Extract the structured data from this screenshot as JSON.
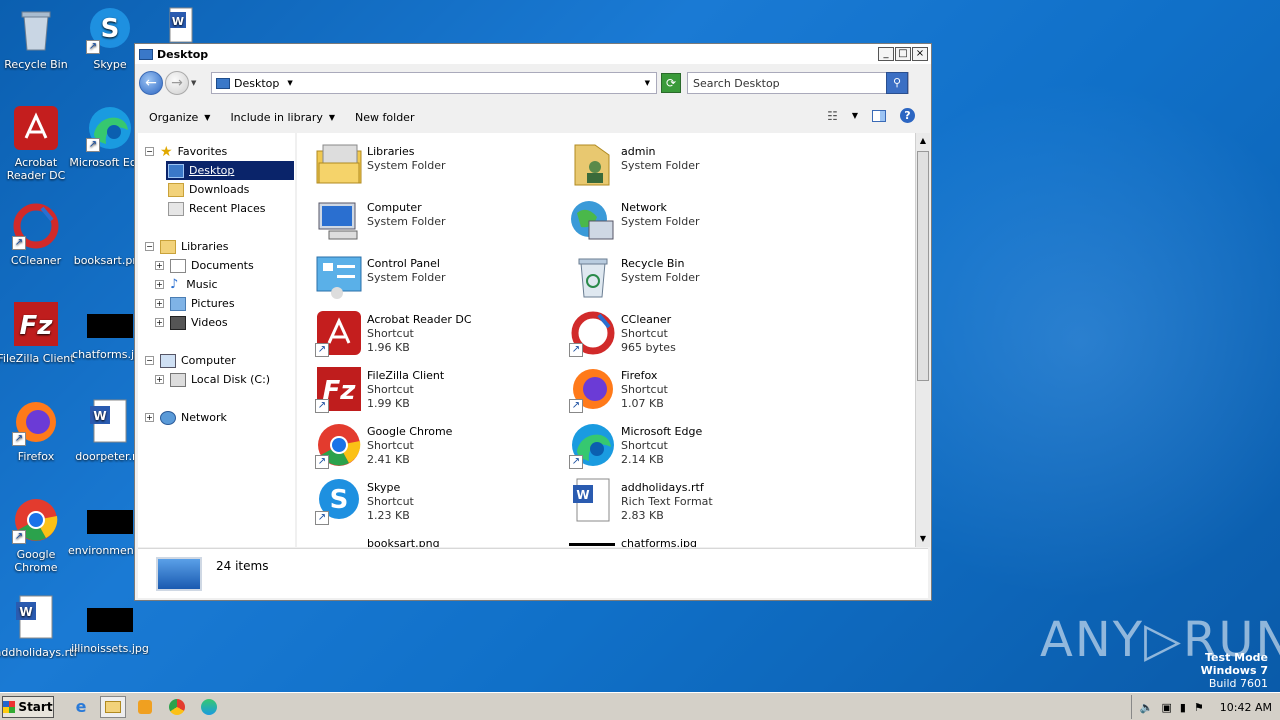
{
  "desktop": {
    "icons": [
      {
        "label": "Recycle Bin"
      },
      {
        "label": "Skype"
      },
      {
        "label": "Acrobat Reader DC"
      },
      {
        "label": "Microsoft Edge"
      },
      {
        "label": "CCleaner"
      },
      {
        "label": "booksart.png"
      },
      {
        "label": "FileZilla Client"
      },
      {
        "label": "chatforms.jpg"
      },
      {
        "label": "Firefox"
      },
      {
        "label": "doorpeter.rtf"
      },
      {
        "label": "Google Chrome"
      },
      {
        "label": "environmentwhere.jpg"
      },
      {
        "label": "addholidays.rtf"
      },
      {
        "label": "illinoissets.jpg"
      }
    ]
  },
  "window": {
    "title": "Desktop",
    "controls": {
      "minimize": "_",
      "maximize": "□",
      "close": "×"
    },
    "address": {
      "path": "Desktop"
    },
    "search": {
      "placeholder": "Search Desktop"
    },
    "toolbar": {
      "organize": "Organize",
      "include": "Include in library",
      "new_folder": "New folder"
    }
  },
  "nav": {
    "favorites": "Favorites",
    "desktop": "Desktop",
    "downloads": "Downloads",
    "recent": "Recent Places",
    "libraries": "Libraries",
    "documents": "Documents",
    "music": "Music",
    "pictures": "Pictures",
    "videos": "Videos",
    "computer": "Computer",
    "localdisk": "Local Disk (C:)",
    "network": "Network"
  },
  "items": [
    {
      "name": "Libraries",
      "type": "System Folder",
      "size": ""
    },
    {
      "name": "admin",
      "type": "System Folder",
      "size": ""
    },
    {
      "name": "Computer",
      "type": "System Folder",
      "size": ""
    },
    {
      "name": "Network",
      "type": "System Folder",
      "size": ""
    },
    {
      "name": "Control Panel",
      "type": "System Folder",
      "size": ""
    },
    {
      "name": "Recycle Bin",
      "type": "System Folder",
      "size": ""
    },
    {
      "name": "Acrobat Reader DC",
      "type": "Shortcut",
      "size": "1.96 KB"
    },
    {
      "name": "CCleaner",
      "type": "Shortcut",
      "size": "965 bytes"
    },
    {
      "name": "FileZilla Client",
      "type": "Shortcut",
      "size": "1.99 KB"
    },
    {
      "name": "Firefox",
      "type": "Shortcut",
      "size": "1.07 KB"
    },
    {
      "name": "Google Chrome",
      "type": "Shortcut",
      "size": "2.41 KB"
    },
    {
      "name": "Microsoft Edge",
      "type": "Shortcut",
      "size": "2.14 KB"
    },
    {
      "name": "Skype",
      "type": "Shortcut",
      "size": "1.23 KB"
    },
    {
      "name": "addholidays.rtf",
      "type": "Rich Text Format",
      "size": "2.83 KB"
    },
    {
      "name": "booksart.png",
      "type": "",
      "size": ""
    },
    {
      "name": "chatforms.jpg",
      "type": "",
      "size": ""
    }
  ],
  "status": {
    "count": "24 items"
  },
  "taskbar": {
    "start": "Start",
    "clock": "10:42 AM"
  },
  "watermark": {
    "mode": "Test Mode",
    "os": "Windows 7",
    "build": "Build 7601",
    "brand": "ANY▷RUN"
  }
}
